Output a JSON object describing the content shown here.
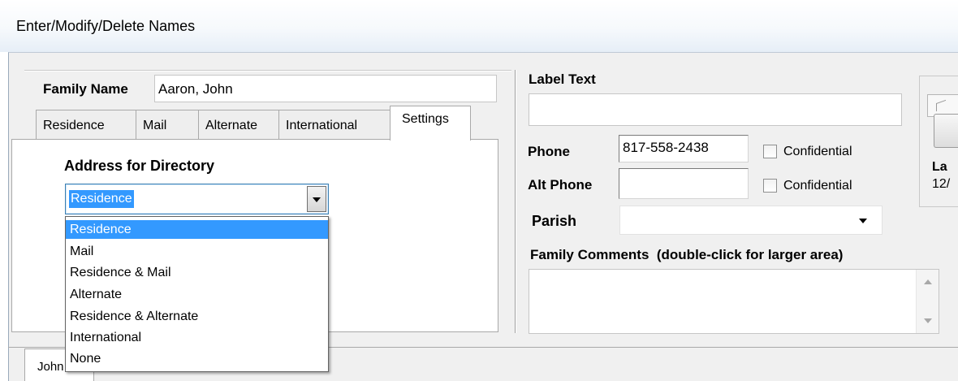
{
  "window": {
    "title": "Enter/Modify/Delete Names"
  },
  "family_name": {
    "label": "Family Name",
    "value": "Aaron, John"
  },
  "tabs": [
    {
      "label": "Residence"
    },
    {
      "label": "Mail"
    },
    {
      "label": "Alternate"
    },
    {
      "label": "International"
    },
    {
      "label": "Settings",
      "active": true
    }
  ],
  "settings": {
    "address_label": "Address for Directory",
    "selected": "Residence",
    "options": [
      "Residence",
      "Mail",
      "Residence & Mail",
      "Alternate",
      "Residence & Alternate",
      "International",
      "None"
    ]
  },
  "label_text": {
    "label": "Label Text",
    "value": ""
  },
  "phone": {
    "label": "Phone",
    "value": "817-558-2438",
    "confidential_label": "Confidential",
    "confidential_checked": false
  },
  "alt_phone": {
    "label": "Alt Phone",
    "value": "",
    "confidential_label": "Confidential",
    "confidential_checked": false
  },
  "parish": {
    "label": "Parish",
    "value": ""
  },
  "family_comments": {
    "label": "Family Comments  (double-click for larger area)",
    "value": ""
  },
  "right_panel": {
    "partial_label": "La",
    "partial_value": "12/"
  },
  "bottom_tab": {
    "label": "John"
  }
}
